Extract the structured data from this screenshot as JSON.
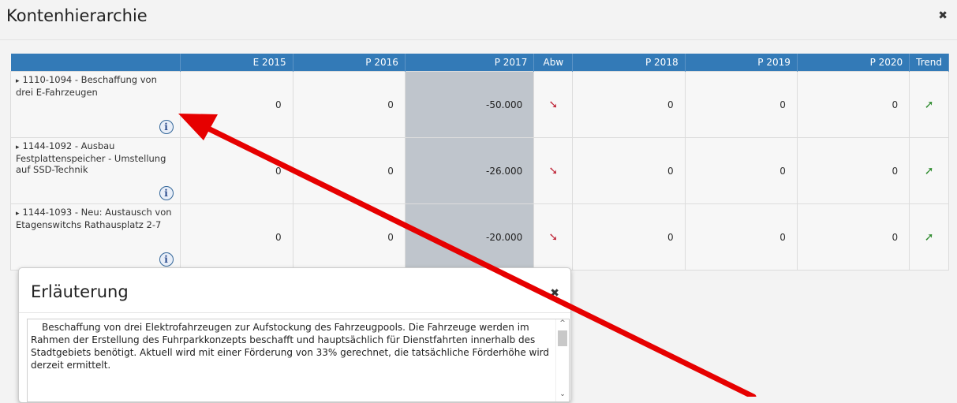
{
  "modal": {
    "title": "Kontenhierarchie",
    "close_glyph": "✖"
  },
  "table": {
    "headers": [
      "",
      "E 2015",
      "P 2016",
      "P 2017",
      "Abw",
      "P 2018",
      "P 2019",
      "P 2020",
      "Trend"
    ],
    "rows": [
      {
        "label": "1110-1094 - Beschaffung von drei E-Fahrzeugen",
        "e2015": "0",
        "p2016": "0",
        "p2017": "-50.000",
        "p2018": "0",
        "p2019": "0",
        "p2020": "0",
        "abw_icon": "arrow-down-right-icon",
        "trend_icon": "arrow-up-right-icon"
      },
      {
        "label": "1144-1092 - Ausbau Festplattenspeicher - Umstellung auf SSD-Technik",
        "e2015": "0",
        "p2016": "0",
        "p2017": "-26.000",
        "p2018": "0",
        "p2019": "0",
        "p2020": "0",
        "abw_icon": "arrow-down-right-icon",
        "trend_icon": "arrow-up-right-icon"
      },
      {
        "label": "1144-1093 - Neu: Austausch von Etagenswitchs Rathausplatz 2-7",
        "e2015": "0",
        "p2016": "0",
        "p2017": "-20.000",
        "p2018": "0",
        "p2019": "0",
        "p2020": "0",
        "abw_icon": "arrow-down-right-icon",
        "trend_icon": "arrow-up-right-icon"
      }
    ],
    "info_glyph": "i",
    "expand_glyph": "▸",
    "down_glyph": "➘",
    "up_glyph": "➚"
  },
  "panel": {
    "title": "Erläuterung",
    "close_glyph": "✖",
    "text": "Beschaffung von drei Elektrofahrzeugen zur Aufstockung des Fahrzeugpools. Die Fahrzeuge werden im Rahmen der Erstellung des Fuhrparkkonzepts beschafft und hauptsächlich für Dienstfahrten innerhalb des Stadtgebiets benötigt. Aktuell wird mit einer Förderung von 33% gerechnet, die tatsächliche Förderhöhe wird derzeit ermittelt.",
    "scroll_up_glyph": "^",
    "scroll_down_glyph": "⌄"
  },
  "colors": {
    "header": "#337ab7",
    "highlight": "#bfc5cc",
    "annotation": "#e60000",
    "down": "#c0293b",
    "up": "#2e8b2e"
  }
}
